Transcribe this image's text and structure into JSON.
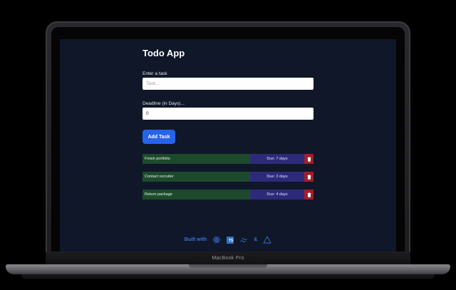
{
  "device": {
    "label": "MacBook Pro"
  },
  "app": {
    "title": "Todo App",
    "task_field": {
      "label": "Enter a task",
      "placeholder": "Task..."
    },
    "deadline_field": {
      "label": "Deadline (in Days)...",
      "value": "0"
    },
    "add_button": "Add Task"
  },
  "tasks": [
    {
      "name": "Finish portfolio",
      "due": "Due: 7 days"
    },
    {
      "name": "Contact recruiter",
      "due": "Due: 2 days"
    },
    {
      "name": "Return package",
      "due": "Due: 4 days"
    }
  ],
  "footer": {
    "text": "Built with",
    "ampersand": "&",
    "icons": [
      "react-icon",
      "typescript-icon",
      "tailwind-icon",
      "vercel-triangle-icon"
    ],
    "ts_badge": "TS"
  },
  "colors": {
    "screen_bg": "#0f1729",
    "accent": "#2563eb",
    "task_name_bg": "#1e4a2c",
    "task_due_bg": "#2e2a7a",
    "delete_bg": "#a01f2a"
  }
}
